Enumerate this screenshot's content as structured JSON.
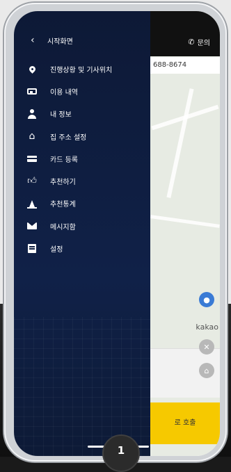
{
  "drawer": {
    "back_label": "시작화면",
    "items": [
      {
        "label": "진행상황 및 기사위치",
        "icon": "location-pin-icon"
      },
      {
        "label": "이용 내역",
        "icon": "id-card-icon"
      },
      {
        "label": "내 정보",
        "icon": "person-icon"
      },
      {
        "label": "집 주소 설정",
        "icon": "home-icon"
      },
      {
        "label": "카드 등록",
        "icon": "credit-card-icon"
      },
      {
        "label": "추천하기",
        "icon": "thumbs-up-icon"
      },
      {
        "label": "추천통계",
        "icon": "stats-icon"
      },
      {
        "label": "메시지함",
        "icon": "mail-icon"
      },
      {
        "label": "설정",
        "icon": "settings-icon"
      }
    ]
  },
  "map": {
    "inquiry_label": "문의",
    "phone_number_partial": "688-8674",
    "map_brand": "kakao",
    "call_button_partial": "로 호출"
  },
  "step_badge": "1",
  "colors": {
    "drawer_bg": "#0f1d3f",
    "call_bar": "#f6c900",
    "location_button": "#3a7bd5"
  }
}
